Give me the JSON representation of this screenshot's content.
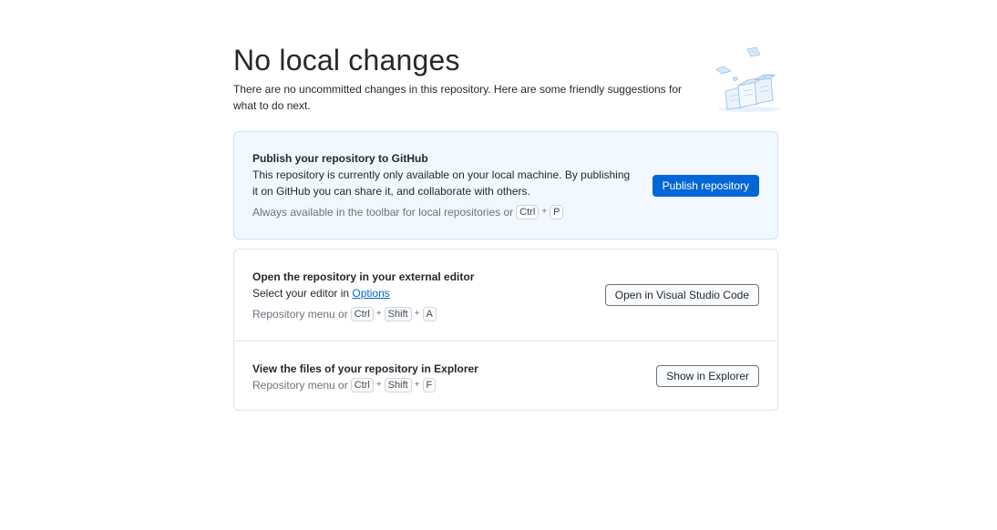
{
  "header": {
    "title": "No local changes",
    "subtitle": "There are no uncommitted changes in this repository. Here are some friendly suggestions for what to do next."
  },
  "publish": {
    "title": "Publish your repository to GitHub",
    "description": "This repository is currently only available on your local machine. By publishing it on GitHub you can share it, and collaborate with others.",
    "hint_text": "Always available in the toolbar for local repositories or",
    "shortcut": [
      "Ctrl",
      "P"
    ],
    "button_label": "Publish repository"
  },
  "open_editor": {
    "title": "Open the repository in your external editor",
    "description_prefix": "Select your editor in",
    "description_link": "Options",
    "hint_text": "Repository menu or",
    "shortcut": [
      "Ctrl",
      "Shift",
      "A"
    ],
    "button_label": "Open in Visual Studio Code"
  },
  "show_explorer": {
    "title": "View the files of your repository in Explorer",
    "hint_text": "Repository menu or",
    "shortcut": [
      "Ctrl",
      "Shift",
      "F"
    ],
    "button_label": "Show in Explorer"
  },
  "icons": {
    "illustration": "empty-repo-illustration"
  },
  "colors": {
    "accent": "#0366d6",
    "highlight_bg": "#f1f8ff",
    "highlight_border": "#c8e1ff",
    "border": "#e1e4e8",
    "muted_text": "#6a737d"
  }
}
